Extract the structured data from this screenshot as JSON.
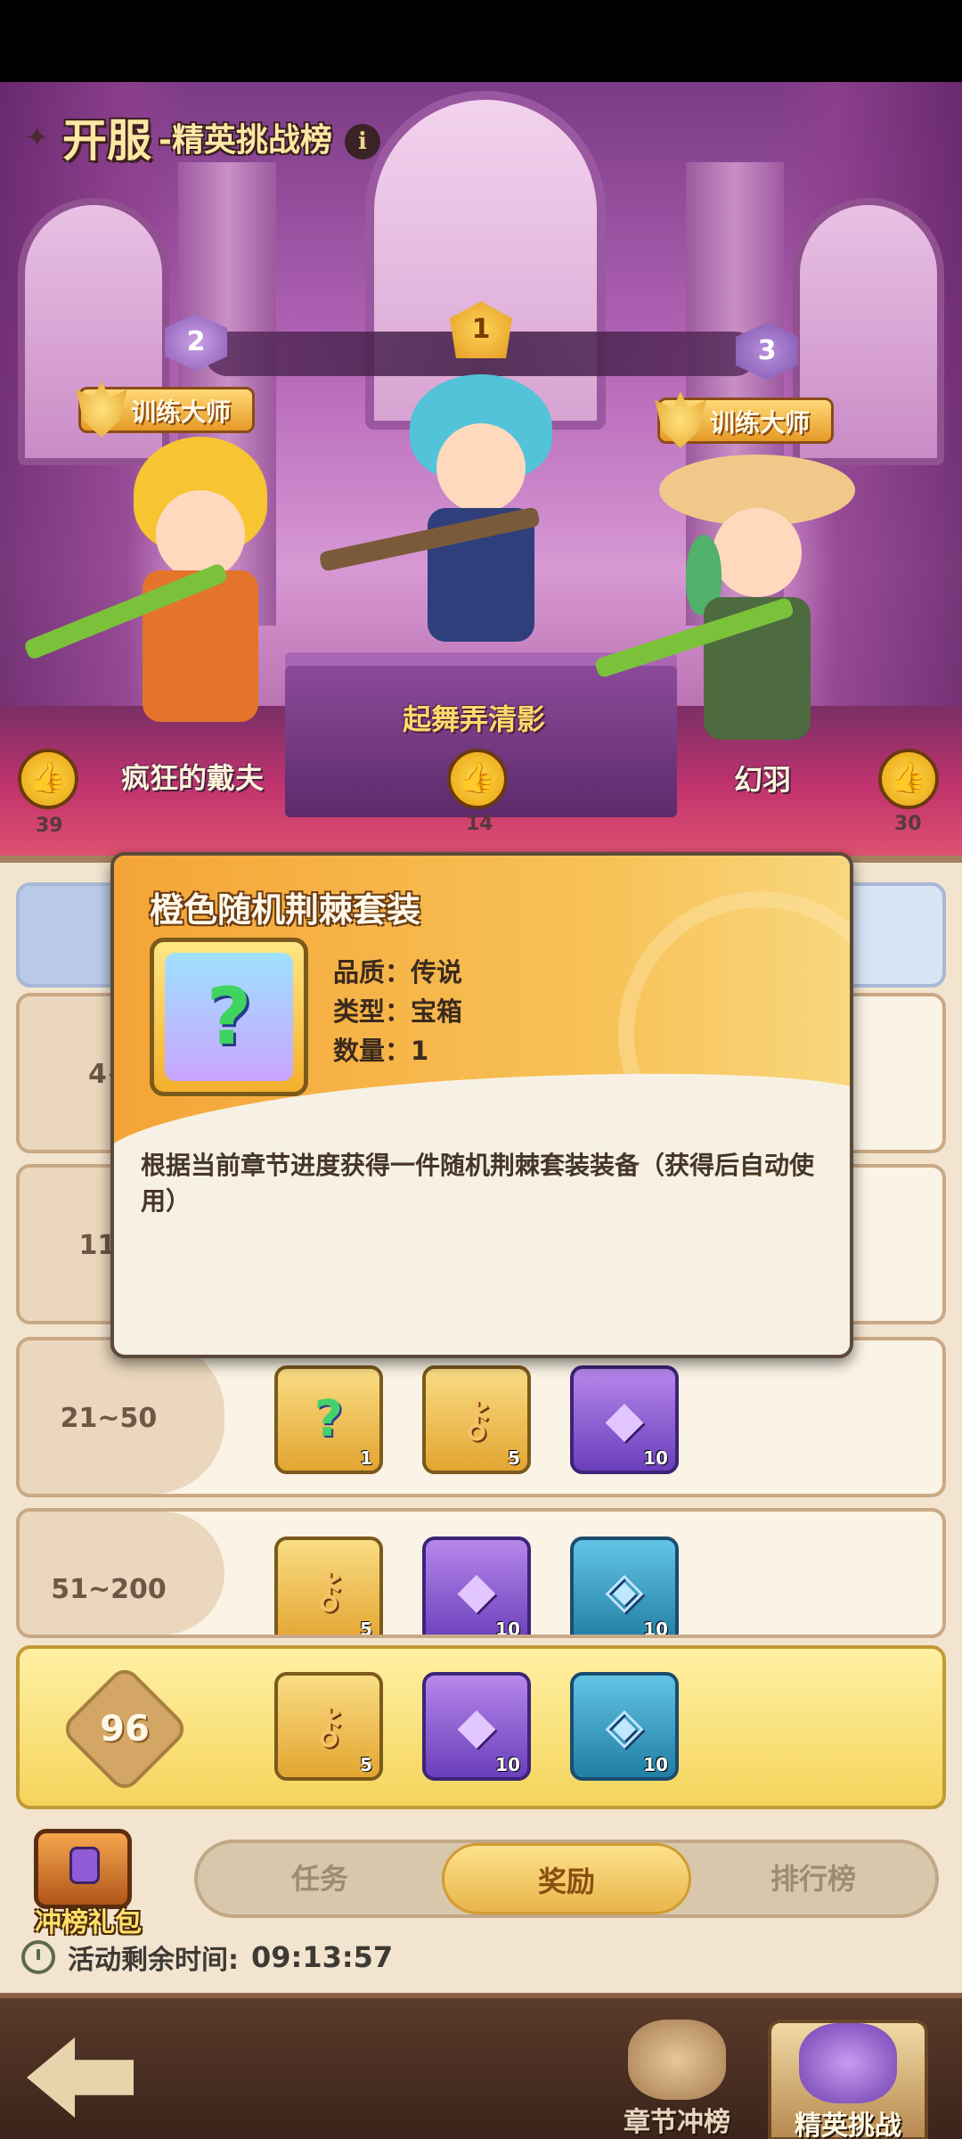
{
  "header": {
    "title_main": "开服",
    "title_sub": "-精英挑战榜",
    "info_label": "i"
  },
  "podium": {
    "rank_badges": [
      "1",
      "2",
      "3"
    ],
    "honor_title": "训练大师",
    "players": [
      {
        "rank": 2,
        "name": "疯狂的戴夫",
        "likes": "39"
      },
      {
        "rank": 1,
        "name": "起舞弄清影",
        "likes": "14"
      },
      {
        "rank": 3,
        "name": "幻羽",
        "likes": "30"
      }
    ]
  },
  "rows": [
    {
      "label": "4~",
      "items": []
    },
    {
      "label": "11~",
      "items": []
    },
    {
      "label": "21~50",
      "items": [
        {
          "kind": "box",
          "qty": "1"
        },
        {
          "kind": "key",
          "qty": "5"
        },
        {
          "kind": "gem",
          "qty": "10"
        }
      ]
    },
    {
      "label": "51~200",
      "items": [
        {
          "kind": "key",
          "qty": "5"
        },
        {
          "kind": "gem",
          "qty": "10"
        },
        {
          "kind": "crystal",
          "qty": "10"
        }
      ]
    }
  ],
  "my_rank": {
    "rank": "96",
    "items": [
      {
        "kind": "key",
        "qty": "5"
      },
      {
        "kind": "gem",
        "qty": "10"
      },
      {
        "kind": "crystal",
        "qty": "10"
      }
    ]
  },
  "popup": {
    "title": "橙色随机荆棘套装",
    "quality": "品质：传说",
    "type": "类型：宝箱",
    "count": "数量：1",
    "description": "根据当前章节进度获得一件随机荆棘套装装备（获得后自动使用）",
    "icon_glyph": "?"
  },
  "tabs": [
    "任务",
    "奖励",
    "排行榜"
  ],
  "active_tab": "奖励",
  "gift_pack": {
    "label": "冲榜礼包"
  },
  "timer": {
    "label": "活动剩余时间:",
    "value": "09:13:57"
  },
  "bottom_nav": {
    "chapter_label": "章节冲榜",
    "elite_label": "精英挑战"
  },
  "colors": {
    "accent_gold": "#f5a436",
    "panel_bg": "#f2e4cf",
    "hall_purple": "#b465b8",
    "my_row_yellow": "#f5d45c"
  },
  "icons": {
    "back": "back-arrow-icon",
    "like": "thumbs-up-icon",
    "clock": "clock-icon",
    "info": "info-icon",
    "key": "key-icon",
    "gem": "purple-gem-icon",
    "crystal": "blue-crystal-icon",
    "box": "mystery-box-icon"
  }
}
